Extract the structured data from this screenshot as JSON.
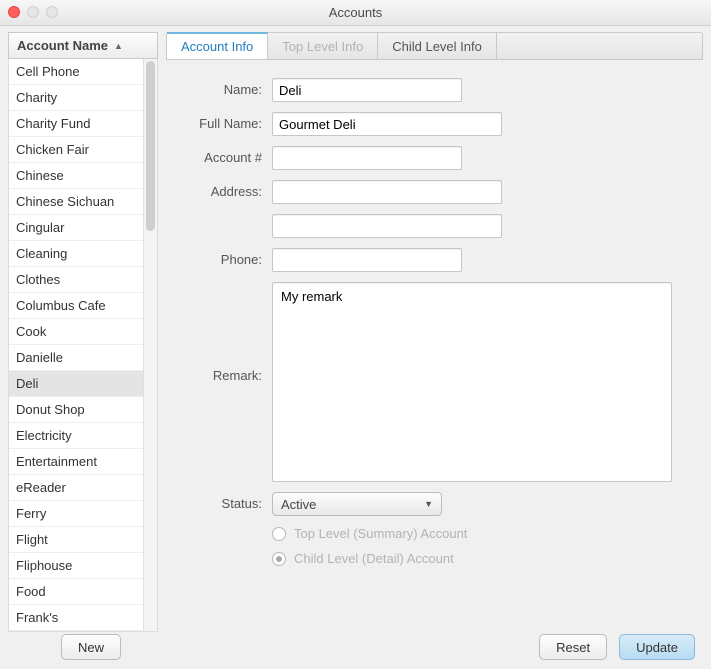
{
  "window": {
    "title": "Accounts"
  },
  "sidebar": {
    "header": "Account Name",
    "selected": "Deli",
    "items": [
      "Cell Phone",
      "Charity",
      "Charity Fund",
      "Chicken Fair",
      "Chinese",
      "Chinese Sichuan",
      "Cingular",
      "Cleaning",
      "Clothes",
      "Columbus Cafe",
      "Cook",
      "Danielle",
      "Deli",
      "Donut Shop",
      "Electricity",
      "Entertainment",
      "eReader",
      "Ferry",
      "Flight",
      "Fliphouse",
      "Food",
      "Frank's"
    ]
  },
  "tabs": {
    "items": [
      {
        "label": "Account Info",
        "state": "active"
      },
      {
        "label": "Top Level Info",
        "state": "disabled"
      },
      {
        "label": "Child Level Info",
        "state": "normal"
      }
    ]
  },
  "form": {
    "labels": {
      "name": "Name:",
      "full_name": "Full Name:",
      "account_num": "Account #",
      "address": "Address:",
      "phone": "Phone:",
      "remark": "Remark:",
      "status": "Status:"
    },
    "values": {
      "name": "Deli",
      "full_name": "Gourmet Deli",
      "account_num": "",
      "address1": "",
      "address2": "",
      "phone": "",
      "remark": "My remark",
      "status": "Active"
    },
    "radios": {
      "top": "Top Level (Summary) Account",
      "child": "Child Level (Detail) Account"
    }
  },
  "buttons": {
    "new": "New",
    "reset": "Reset",
    "update": "Update"
  }
}
